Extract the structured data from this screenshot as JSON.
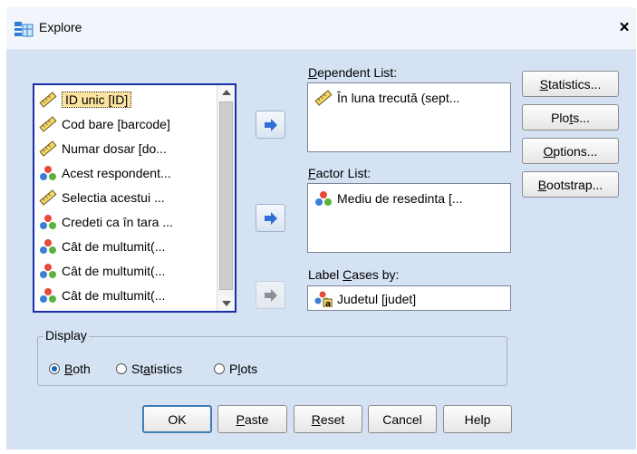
{
  "window": {
    "title": "Explore",
    "close_label": "×"
  },
  "variables": [
    {
      "label": "ID unic [ID]",
      "icon": "ruler-icon",
      "selected": true
    },
    {
      "label": "Cod bare [barcode]",
      "icon": "ruler-icon"
    },
    {
      "label": "Numar dosar [do...",
      "icon": "ruler-icon"
    },
    {
      "label": "Acest respondent...",
      "icon": "nominal-icon"
    },
    {
      "label": "Selectia acestui ...",
      "icon": "ruler-icon"
    },
    {
      "label": "Credeti ca în tara ...",
      "icon": "nominal-icon"
    },
    {
      "label": "Cât de multumit(...",
      "icon": "nominal-icon"
    },
    {
      "label": "Cât de multumit(...",
      "icon": "nominal-icon"
    },
    {
      "label": "Cât de multumit(...",
      "icon": "nominal-icon"
    }
  ],
  "dependent": {
    "mnemonic": "D",
    "rest": "ependent List:",
    "item": "În luna trecută (sept..."
  },
  "factor": {
    "mnemonic": "F",
    "rest": "actor List:",
    "item": "Mediu de resedinta [..."
  },
  "label_cases": {
    "pre": "Label ",
    "mnemonic": "C",
    "rest": "ases by:",
    "item": "Judetul [judet]"
  },
  "side_buttons": {
    "statistics": {
      "mnemonic": "S",
      "rest": "tatistics..."
    },
    "plots": {
      "pre": "Plo",
      "mnemonic": "t",
      "rest": "s..."
    },
    "options": {
      "mnemonic": "O",
      "rest": "ptions..."
    },
    "bootstrap": {
      "mnemonic": "B",
      "rest": "ootstrap..."
    }
  },
  "display": {
    "legend": "Display",
    "both": {
      "mnemonic": "B",
      "rest": "oth",
      "checked": true
    },
    "statistics": {
      "pre": "St",
      "mnemonic": "a",
      "rest": "tistics"
    },
    "plots": {
      "pre": "P",
      "mnemonic": "l",
      "rest": "ots"
    }
  },
  "bottom_buttons": {
    "ok": "OK",
    "paste": {
      "mnemonic": "P",
      "rest": "aste"
    },
    "reset": {
      "mnemonic": "R",
      "rest": "eset"
    },
    "cancel": "Cancel",
    "help": "Help"
  },
  "colors": {
    "client_bg": "#d5e2f3",
    "arrow_blue": "#2f6fd6",
    "selection": "#fbe4a0"
  }
}
